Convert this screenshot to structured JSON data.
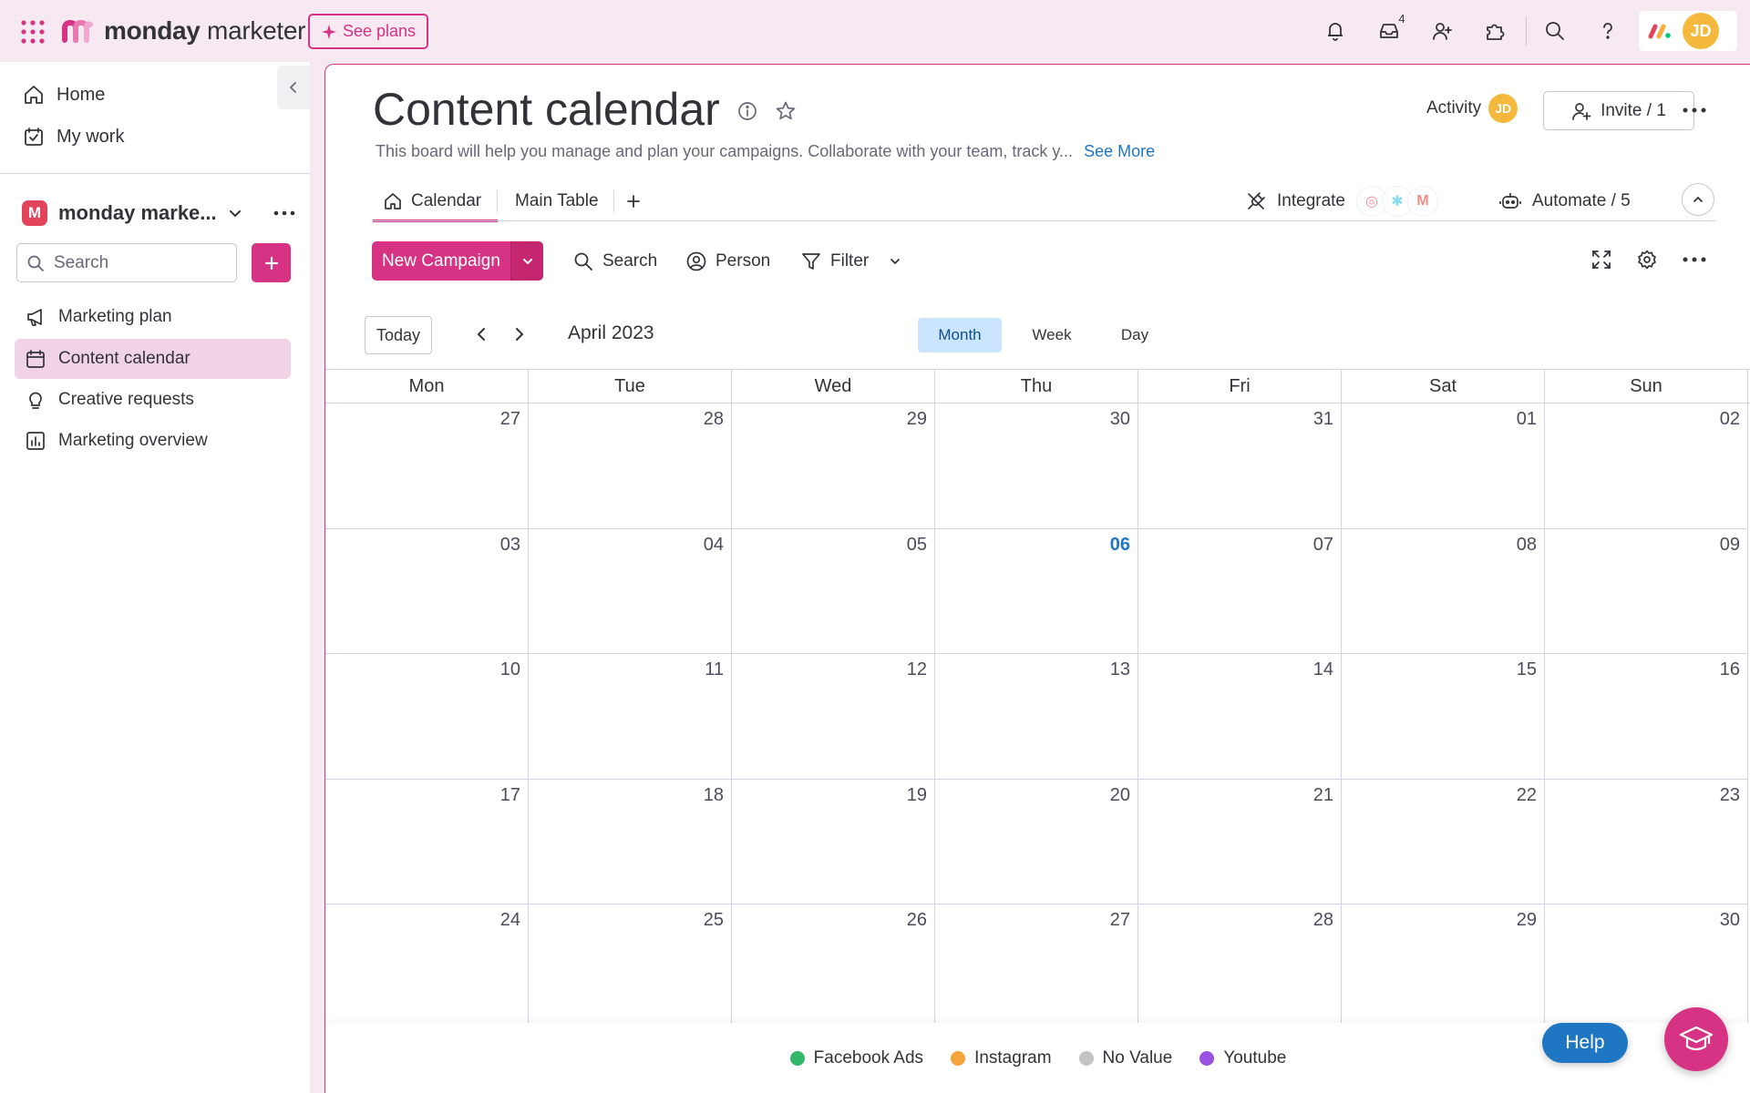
{
  "topbar": {
    "logo_brand": "monday",
    "logo_product": "marketer",
    "see_plans_label": "See plans",
    "inbox_count": "4",
    "avatar_initials": "JD"
  },
  "sidebar": {
    "home_label": "Home",
    "mywork_label": "My work",
    "workspace_initial": "M",
    "workspace_name": "monday marke...",
    "search_placeholder": "Search",
    "boards": [
      {
        "label": "Marketing plan"
      },
      {
        "label": "Content calendar"
      },
      {
        "label": "Creative requests"
      },
      {
        "label": "Marketing overview"
      }
    ]
  },
  "board": {
    "title": "Content calendar",
    "description": "This board will help you manage and plan your campaigns. Collaborate with your team, track y...",
    "see_more": "See More",
    "activity_label": "Activity",
    "activity_avatar": "JD",
    "invite_label": "Invite / 1",
    "tabs": [
      {
        "label": "Calendar"
      },
      {
        "label": "Main Table"
      }
    ],
    "integrate_label": "Integrate",
    "automate_label": "Automate / 5"
  },
  "toolbar": {
    "new_campaign_label": "New Campaign",
    "search_label": "Search",
    "person_label": "Person",
    "filter_label": "Filter"
  },
  "calendar": {
    "today_label": "Today",
    "month_label": "April 2023",
    "views": [
      "Month",
      "Week",
      "Day"
    ],
    "active_view": "Month",
    "weekdays": [
      "Mon",
      "Tue",
      "Wed",
      "Thu",
      "Fri",
      "Sat",
      "Sun"
    ],
    "days": [
      "27",
      "28",
      "29",
      "30",
      "31",
      "01",
      "02",
      "03",
      "04",
      "05",
      "06",
      "07",
      "08",
      "09",
      "10",
      "11",
      "12",
      "13",
      "14",
      "15",
      "16",
      "17",
      "18",
      "19",
      "20",
      "21",
      "22",
      "23",
      "24",
      "25",
      "26",
      "27",
      "28",
      "29",
      "30"
    ],
    "today_day": "06"
  },
  "legend": [
    {
      "label": "Facebook Ads",
      "color": "#33b86a"
    },
    {
      "label": "Instagram",
      "color": "#f5a33b"
    },
    {
      "label": "No Value",
      "color": "#c4c4c4"
    },
    {
      "label": "Youtube",
      "color": "#9b51e0"
    }
  ],
  "help_label": "Help",
  "colors": {
    "accent": "#d63384",
    "today": "#1f76c2",
    "active_view_bg": "#cce5ff"
  }
}
